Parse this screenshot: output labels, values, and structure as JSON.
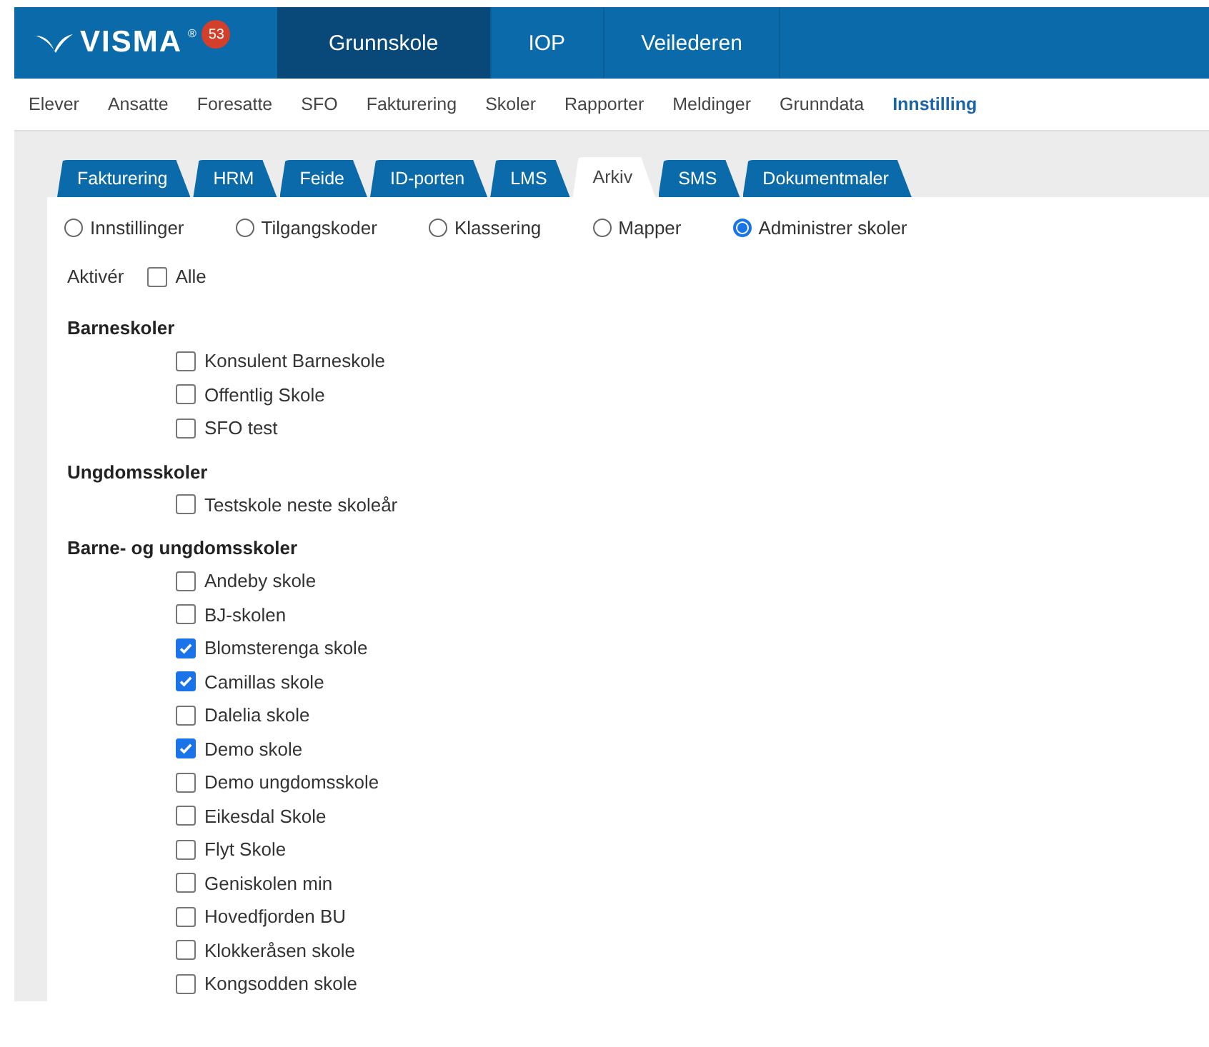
{
  "header": {
    "logo": {
      "text": "VISMA",
      "mark": "®",
      "badge": "53"
    },
    "apps": [
      {
        "label": "Grunnskole",
        "selected": true
      },
      {
        "label": "IOP",
        "selected": false
      },
      {
        "label": "Veilederen",
        "selected": false
      }
    ]
  },
  "menu": [
    {
      "label": "Elever",
      "selected": false
    },
    {
      "label": "Ansatte",
      "selected": false
    },
    {
      "label": "Foresatte",
      "selected": false
    },
    {
      "label": "SFO",
      "selected": false
    },
    {
      "label": "Fakturering",
      "selected": false
    },
    {
      "label": "Skoler",
      "selected": false
    },
    {
      "label": "Rapporter",
      "selected": false
    },
    {
      "label": "Meldinger",
      "selected": false
    },
    {
      "label": "Grunndata",
      "selected": false
    },
    {
      "label": "Innstilling",
      "selected": true
    }
  ],
  "tabs": [
    {
      "label": "Fakturering",
      "selected": false
    },
    {
      "label": "HRM",
      "selected": false
    },
    {
      "label": "Feide",
      "selected": false
    },
    {
      "label": "ID-porten",
      "selected": false
    },
    {
      "label": "LMS",
      "selected": false
    },
    {
      "label": "Arkiv",
      "selected": true
    },
    {
      "label": "SMS",
      "selected": false
    },
    {
      "label": "Dokumentmaler",
      "selected": false
    }
  ],
  "options": [
    {
      "label": "Innstillinger",
      "selected": false
    },
    {
      "label": "Tilgangskoder",
      "selected": false
    },
    {
      "label": "Klassering",
      "selected": false
    },
    {
      "label": "Mapper",
      "selected": false
    },
    {
      "label": "Administrer skoler",
      "selected": true
    }
  ],
  "activate": {
    "label": "Aktivér",
    "all": {
      "label": "Alle",
      "checked": false
    }
  },
  "groups": [
    {
      "title": "Barneskoler",
      "schools": [
        {
          "name": "Konsulent Barneskole",
          "checked": false
        },
        {
          "name": "Offentlig Skole",
          "checked": false
        },
        {
          "name": "SFO test",
          "checked": false
        }
      ]
    },
    {
      "title": "Ungdomsskoler",
      "schools": [
        {
          "name": "Testskole neste skoleår",
          "checked": false
        }
      ]
    },
    {
      "title": "Barne- og ungdomsskoler",
      "schools": [
        {
          "name": "Andeby skole",
          "checked": false
        },
        {
          "name": "BJ-skolen",
          "checked": false
        },
        {
          "name": "Blomsterenga skole",
          "checked": true
        },
        {
          "name": "Camillas skole",
          "checked": true
        },
        {
          "name": "Dalelia skole",
          "checked": false
        },
        {
          "name": "Demo skole",
          "checked": true
        },
        {
          "name": "Demo ungdomsskole",
          "checked": false
        },
        {
          "name": "Eikesdal Skole",
          "checked": false
        },
        {
          "name": "Flyt Skole",
          "checked": false
        },
        {
          "name": "Geniskolen min",
          "checked": false
        },
        {
          "name": "Hovedfjorden BU",
          "checked": false
        },
        {
          "name": "Klokkeråsen skole",
          "checked": false
        },
        {
          "name": "Kongsodden skole",
          "checked": false
        }
      ]
    }
  ]
}
